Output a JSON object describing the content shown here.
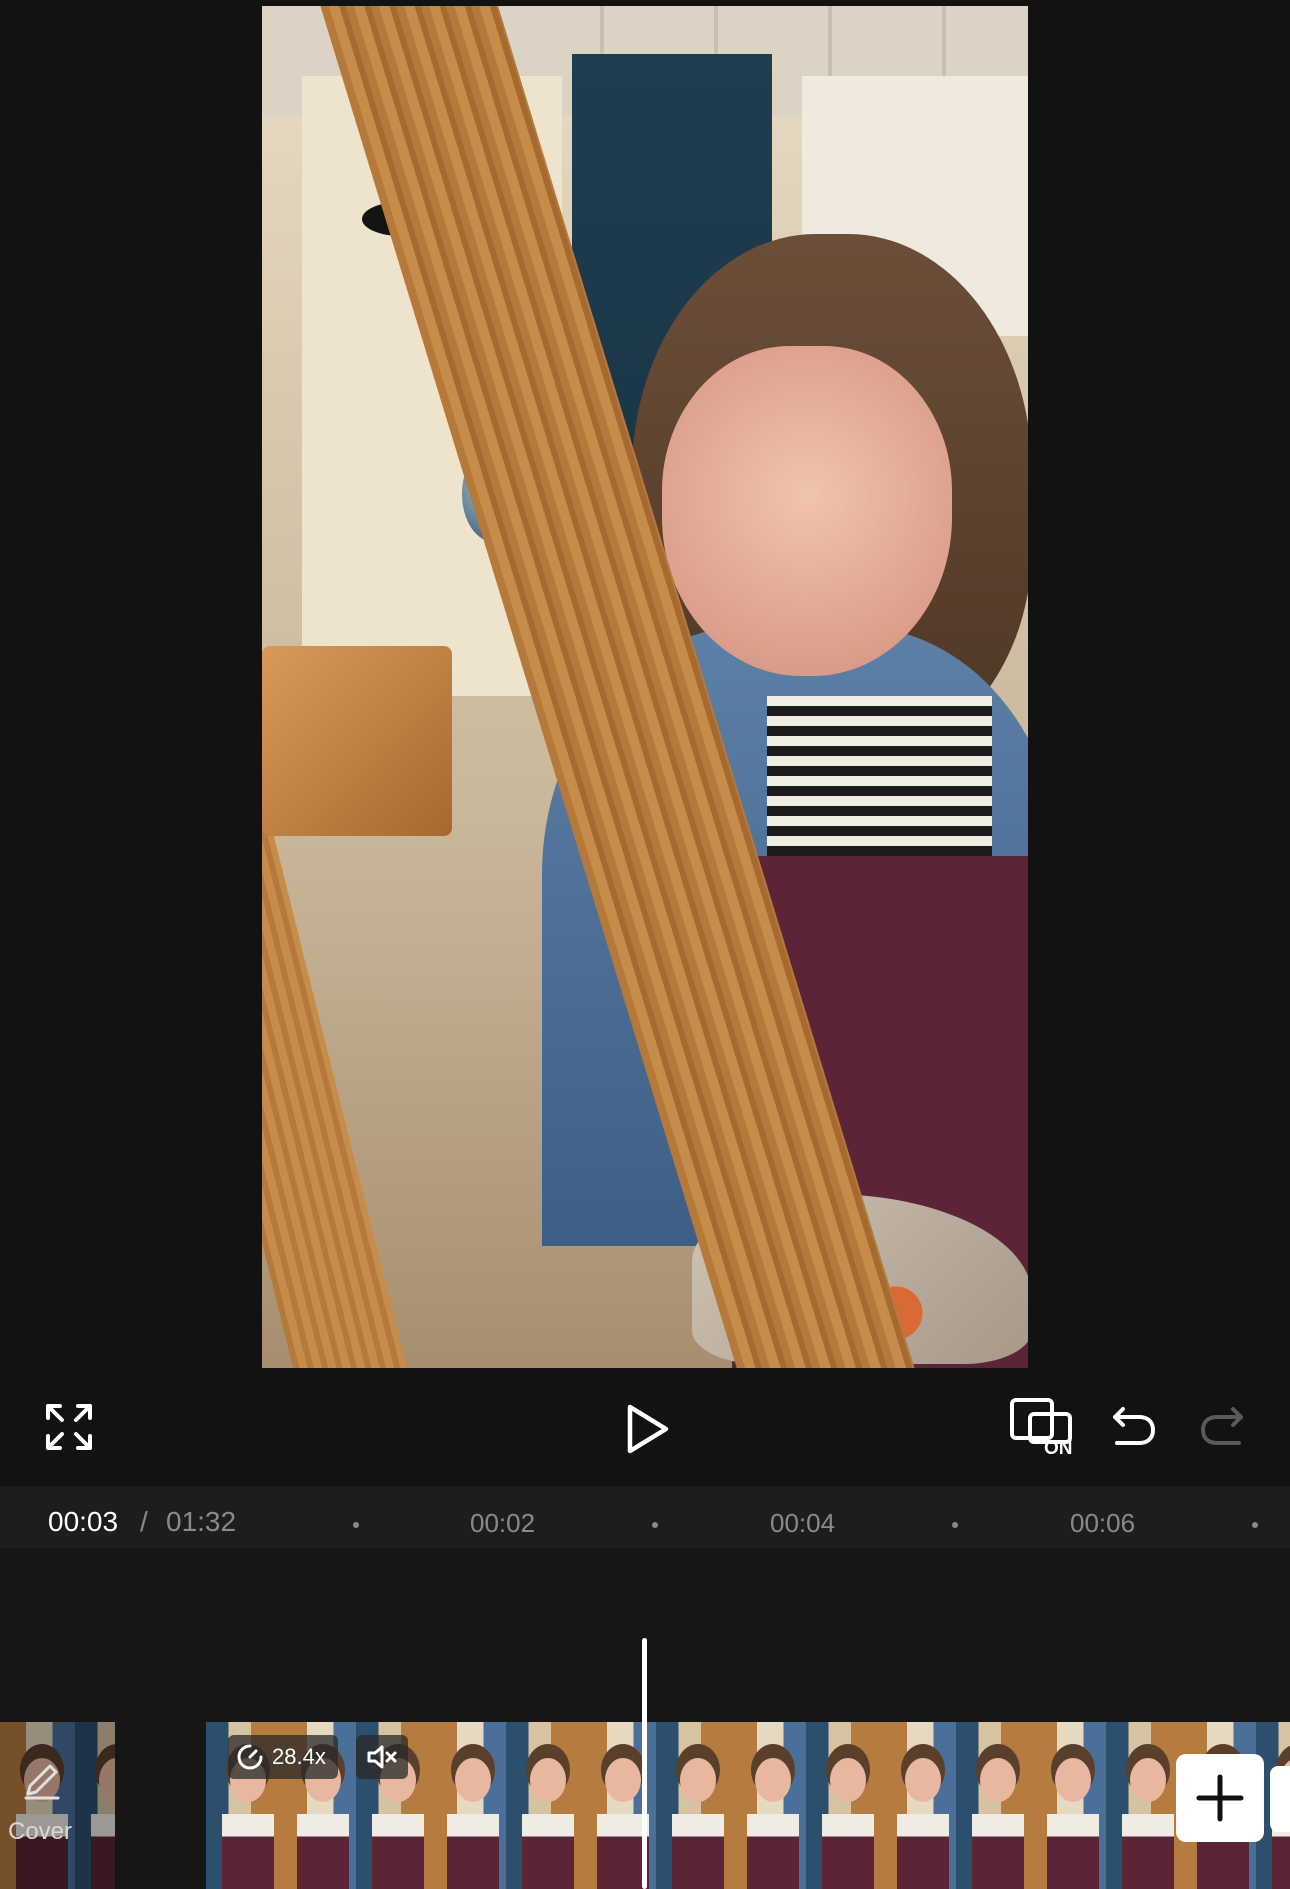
{
  "preview": {
    "alt": "Video preview of a woman painting at an easel"
  },
  "controls": {
    "fullscreen_icon": "fullscreen-icon",
    "play_icon": "play-icon",
    "auto_reframe_icon": "auto-reframe-icon",
    "auto_reframe_label": "ON",
    "undo_icon": "undo-icon",
    "redo_icon": "redo-icon"
  },
  "timeline": {
    "current_time": "00:03",
    "separator": "/",
    "total_time": "01:32",
    "ticks": [
      "00:02",
      "00:04",
      "00:06"
    ]
  },
  "clips": {
    "cover_label": "Cover",
    "cover_icon": "pencil-icon",
    "speed_label": "28.4x",
    "speed_icon": "speed-icon",
    "mute_icon": "mute-icon",
    "add_icon": "plus-icon"
  },
  "colors": {
    "background": "#121212",
    "ruler": "#1d1d1d",
    "muted_text": "#8a8a8a",
    "accent": "#ffffff"
  }
}
